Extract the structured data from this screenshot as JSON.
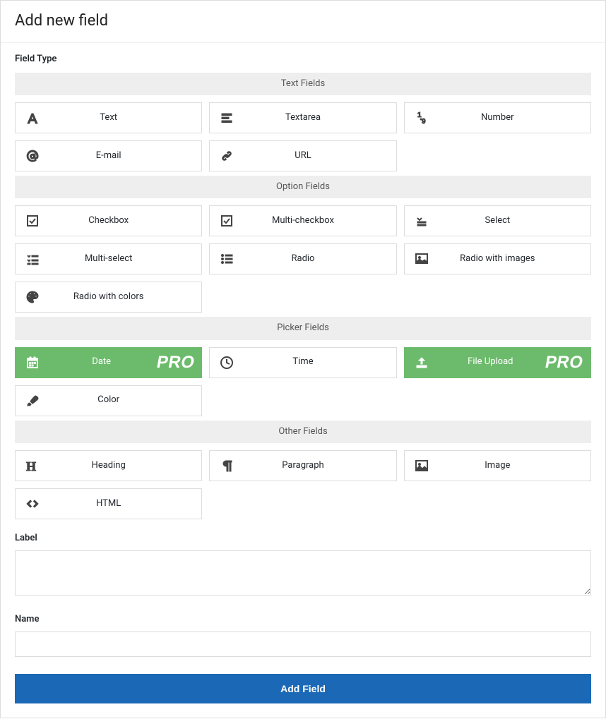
{
  "header": {
    "title": "Add new field"
  },
  "labels": {
    "field_type": "Field Type",
    "label": "Label",
    "name": "Name",
    "submit": "Add Field",
    "pro_badge": "PRO"
  },
  "categories": [
    {
      "key": "text",
      "title": "Text Fields",
      "items": [
        {
          "key": "text",
          "label": "Text",
          "icon": "font",
          "pro": false
        },
        {
          "key": "textarea",
          "label": "Textarea",
          "icon": "align-left",
          "pro": false
        },
        {
          "key": "number",
          "label": "Number",
          "icon": "nine",
          "pro": false
        },
        {
          "key": "email",
          "label": "E-mail",
          "icon": "at",
          "pro": false
        },
        {
          "key": "url",
          "label": "URL",
          "icon": "link",
          "pro": false
        }
      ]
    },
    {
      "key": "option",
      "title": "Option Fields",
      "items": [
        {
          "key": "checkbox",
          "label": "Checkbox",
          "icon": "check-square",
          "pro": false
        },
        {
          "key": "multi-checkbox",
          "label": "Multi-checkbox",
          "icon": "check-square",
          "pro": false
        },
        {
          "key": "select",
          "label": "Select",
          "icon": "select",
          "pro": false
        },
        {
          "key": "multi-select",
          "label": "Multi-select",
          "icon": "tasks",
          "pro": false
        },
        {
          "key": "radio",
          "label": "Radio",
          "icon": "list",
          "pro": false
        },
        {
          "key": "radio-images",
          "label": "Radio with images",
          "icon": "image-o",
          "pro": false
        },
        {
          "key": "radio-colors",
          "label": "Radio with colors",
          "icon": "palette",
          "pro": false
        }
      ]
    },
    {
      "key": "picker",
      "title": "Picker Fields",
      "items": [
        {
          "key": "date",
          "label": "Date",
          "icon": "calendar",
          "pro": true
        },
        {
          "key": "time",
          "label": "Time",
          "icon": "clock",
          "pro": false
        },
        {
          "key": "file",
          "label": "File Upload",
          "icon": "upload",
          "pro": true
        },
        {
          "key": "color",
          "label": "Color",
          "icon": "brush",
          "pro": false
        }
      ]
    },
    {
      "key": "other",
      "title": "Other Fields",
      "items": [
        {
          "key": "heading",
          "label": "Heading",
          "icon": "heading",
          "pro": false
        },
        {
          "key": "paragraph",
          "label": "Paragraph",
          "icon": "paragraph",
          "pro": false
        },
        {
          "key": "image",
          "label": "Image",
          "icon": "image",
          "pro": false
        },
        {
          "key": "html",
          "label": "HTML",
          "icon": "code",
          "pro": false
        }
      ]
    }
  ],
  "form": {
    "label_value": "",
    "name_value": ""
  }
}
